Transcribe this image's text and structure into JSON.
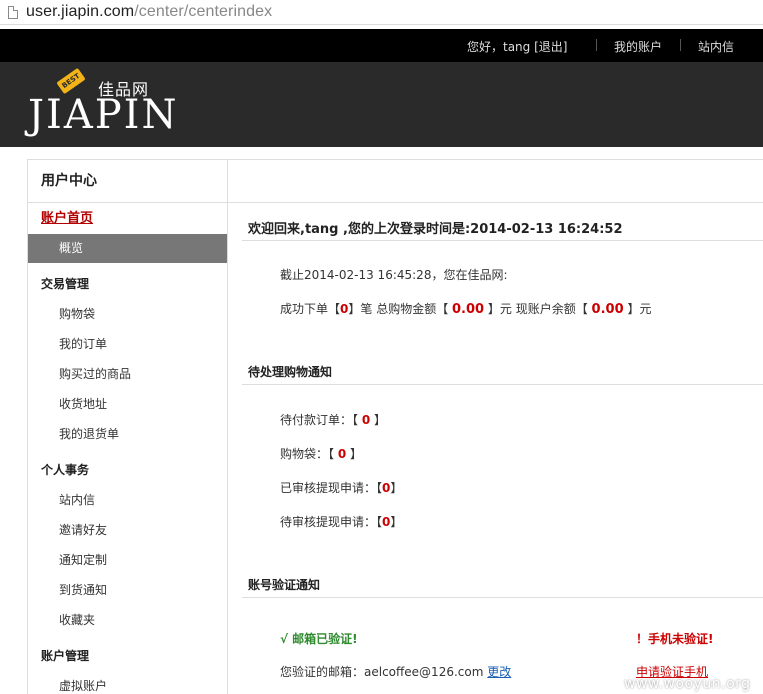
{
  "browser": {
    "url_host": "user.jiapin.com",
    "url_path": "/center/centerindex"
  },
  "topnav": {
    "greeting": "您好，tang [退出]",
    "my_account": "我的账户",
    "messages": "站内信"
  },
  "logo": {
    "brand": "JIAPIN",
    "cn_name": "佳品网",
    "badge": "BEST"
  },
  "sidebar": {
    "title": "用户中心",
    "home": "账户首页",
    "active_item": "概览",
    "sections": [
      {
        "label": "交易管理",
        "items": [
          "购物袋",
          "我的订单",
          "购买过的商品",
          "收货地址",
          "我的退货单"
        ]
      },
      {
        "label": "个人事务",
        "items": [
          "站内信",
          "邀请好友",
          "通知定制",
          "到货通知",
          "收藏夹"
        ]
      },
      {
        "label": "账户管理",
        "items": [
          "虚拟账户"
        ]
      }
    ]
  },
  "main": {
    "welcome": "欢迎回来,tang ,您的上次登录时间是:2014-02-13 16:24:52",
    "as_of": "截止2014-02-13 16:45:28，您在佳品网:",
    "summary": {
      "prefix": "成功下单【",
      "orders": "0",
      "mid1": "】笔 总购物金额【 ",
      "total": "0.00",
      "mid2": " 】元 现账户余额【 ",
      "balance": "0.00",
      "suffix": " 】元"
    },
    "pending_title": "待处理购物通知",
    "pending": [
      {
        "label": "待付款订单：【 ",
        "value": "0",
        "end": " 】"
      },
      {
        "label": "购物袋：【 ",
        "value": "0",
        "end": " 】"
      },
      {
        "label": "已审核提现申请：【",
        "value": "0",
        "end": "】"
      },
      {
        "label": "待审核提现申请：【",
        "value": "0",
        "end": "】"
      }
    ],
    "verify_title": "账号验证通知",
    "email_verified": "√ 邮箱已验证!",
    "phone_unverified": "！手机未验证!",
    "email_label": "您验证的邮箱：",
    "email_value": "aelcoffee@126.com",
    "change_link": "更改",
    "apply_phone": "申请验证手机"
  },
  "watermark": "www.wooyun.org"
}
